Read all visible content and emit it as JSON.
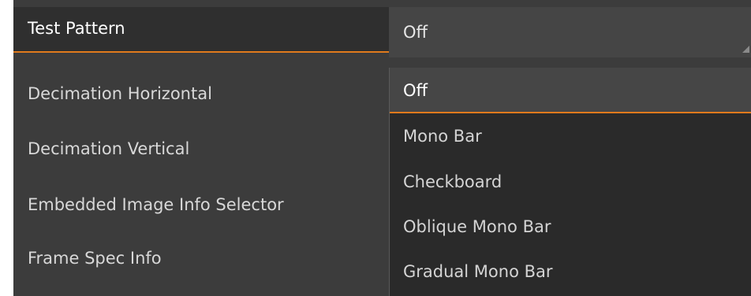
{
  "properties": [
    {
      "label": "Test Pattern"
    },
    {
      "label": "Decimation Horizontal"
    },
    {
      "label": "Decimation Vertical"
    },
    {
      "label": "Embedded Image Info Selector"
    },
    {
      "label": "Frame Spec Info"
    }
  ],
  "test_pattern": {
    "value": "Off",
    "options": [
      "Off",
      "Mono Bar",
      "Checkboard",
      "Oblique Mono Bar",
      "Gradual Mono Bar"
    ],
    "highlighted_option": "Off"
  },
  "colors": {
    "panel_bg": "#3c3c3c",
    "accent": "#e07a1c",
    "dropdown_bg": "#2a2a2a",
    "text": "#d8d8d8"
  },
  "icons": {
    "dropdown": "dropdown-arrow-icon"
  }
}
